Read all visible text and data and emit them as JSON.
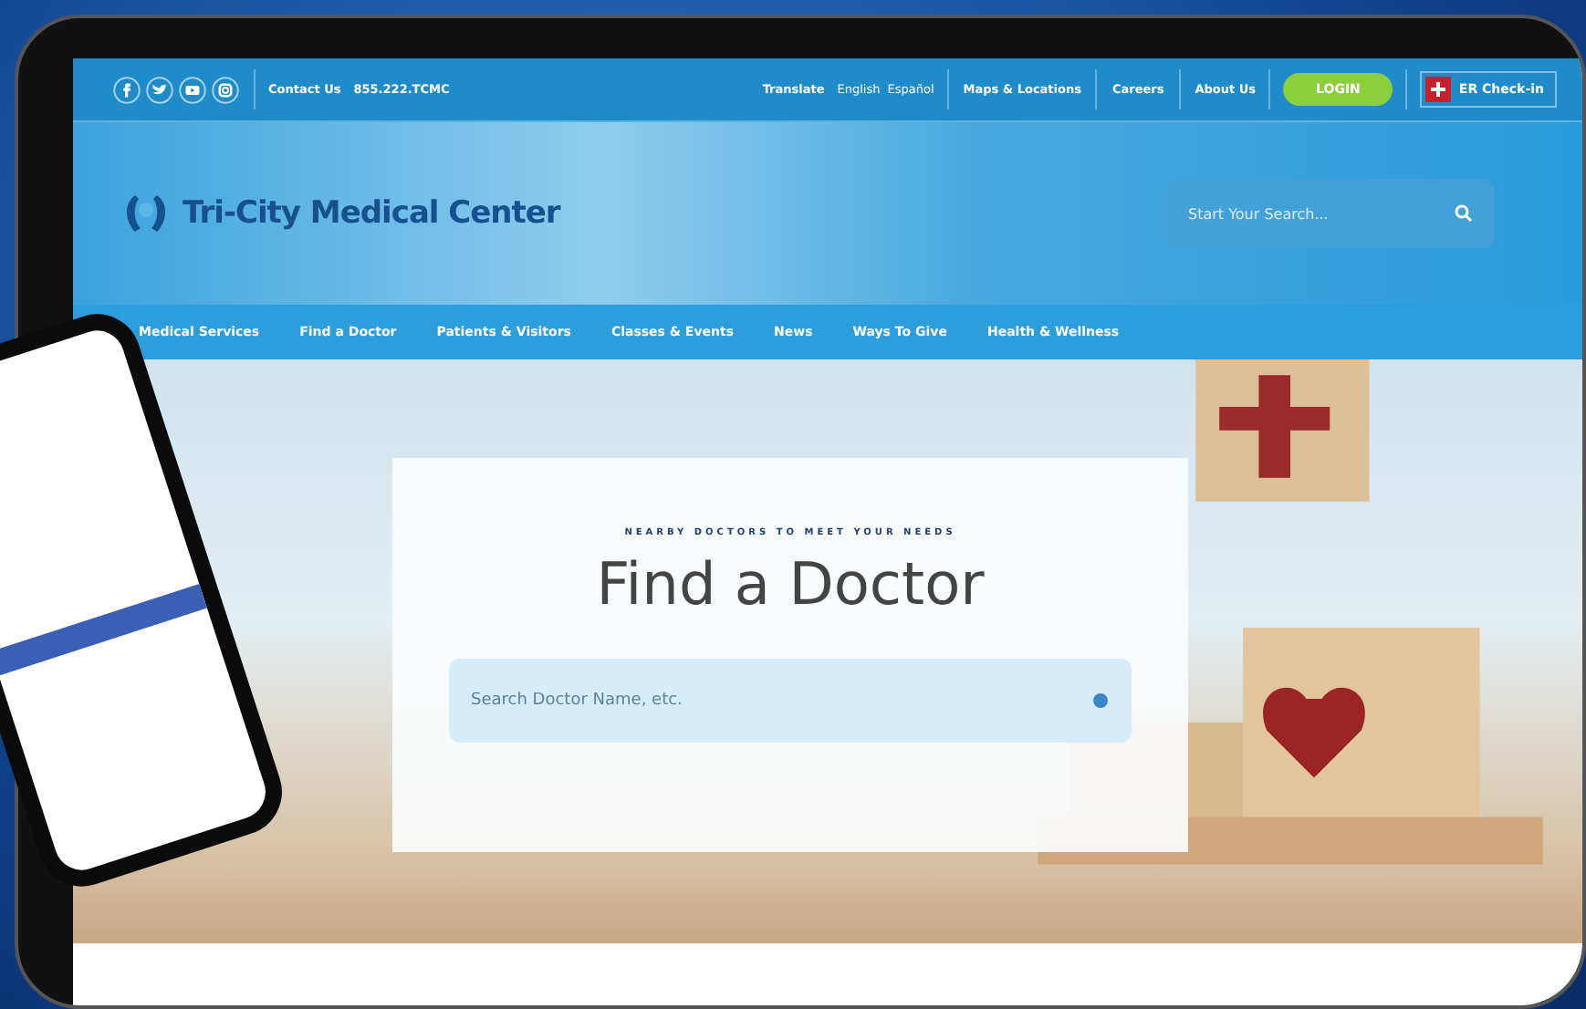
{
  "top_bar": {
    "contact_label": "Contact Us",
    "phone": "855.222.TCMC",
    "translate_label": "Translate",
    "languages": [
      "English",
      "Español"
    ],
    "links": [
      "Maps & Locations",
      "Careers",
      "About Us"
    ],
    "login_button": "LOGIN",
    "er_button": "ER Check-in"
  },
  "header": {
    "logo_text": "Tri-City Medical Center",
    "search": {
      "placeholder": "Start Your Search..."
    }
  },
  "nav": [
    "Medical Services",
    "Find a Doctor",
    "Patients & Visitors",
    "Classes & Events",
    "News",
    "Ways To Give",
    "Health & Wellness"
  ],
  "hero": {
    "eyebrow": "NEARBY DOCTORS TO MEET YOUR NEEDS",
    "title": "Find a Doctor",
    "search": {
      "placeholder": "Search Doctor Name, etc."
    }
  }
}
